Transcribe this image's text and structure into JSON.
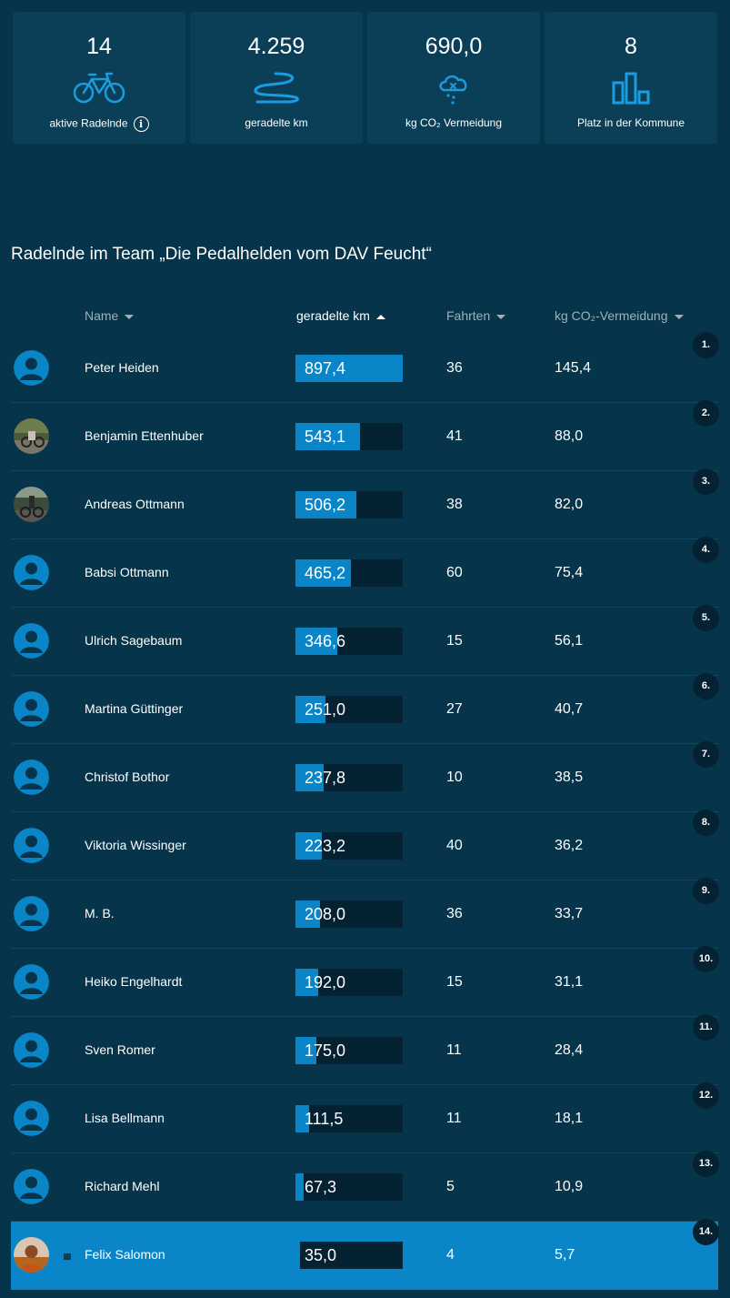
{
  "stats": [
    {
      "value": "14",
      "label": "aktive Radelnde",
      "icon": "bicycle-icon"
    },
    {
      "value": "4.259",
      "label": "geradelte km",
      "icon": "route-icon"
    },
    {
      "value": "690,0",
      "label": "kg CO₂ Vermeidung",
      "icon": "cloud-icon"
    },
    {
      "value": "8",
      "label": "Platz in der Kommune",
      "icon": "bar-chart-icon"
    }
  ],
  "team": {
    "title": "Radelnde im Team „Die Pedalhelden vom DAV Feucht“"
  },
  "table": {
    "headers": {
      "name": "Name",
      "km": "geradelte km",
      "rides": "Fahrten",
      "co2": "kg CO₂-Vermeidung"
    },
    "rows": [
      {
        "rank": "1.",
        "name": "Peter Heiden",
        "km": "897,4",
        "km_value": 897.4,
        "rides": "36",
        "co2": "145,4",
        "avatar": "default"
      },
      {
        "rank": "2.",
        "name": "Benjamin Ettenhuber",
        "km": "543,1",
        "km_value": 543.1,
        "rides": "41",
        "co2": "88,0",
        "avatar": "photo"
      },
      {
        "rank": "3.",
        "name": "Andreas Ottmann",
        "km": "506,2",
        "km_value": 506.2,
        "rides": "38",
        "co2": "82,0",
        "avatar": "photo"
      },
      {
        "rank": "4.",
        "name": "Babsi Ottmann",
        "km": "465,2",
        "km_value": 465.2,
        "rides": "60",
        "co2": "75,4",
        "avatar": "default"
      },
      {
        "rank": "5.",
        "name": "Ulrich Sagebaum",
        "km": "346,6",
        "km_value": 346.6,
        "rides": "15",
        "co2": "56,1",
        "avatar": "default"
      },
      {
        "rank": "6.",
        "name": "Martina Güttinger",
        "km": "251,0",
        "km_value": 251.0,
        "rides": "27",
        "co2": "40,7",
        "avatar": "default"
      },
      {
        "rank": "7.",
        "name": "Christof Bothor",
        "km": "237,8",
        "km_value": 237.8,
        "rides": "10",
        "co2": "38,5",
        "avatar": "default"
      },
      {
        "rank": "8.",
        "name": "Viktoria Wissinger",
        "km": "223,2",
        "km_value": 223.2,
        "rides": "40",
        "co2": "36,2",
        "avatar": "default"
      },
      {
        "rank": "9.",
        "name": "M. B.",
        "km": "208,0",
        "km_value": 208.0,
        "rides": "36",
        "co2": "33,7",
        "avatar": "default"
      },
      {
        "rank": "10.",
        "name": "Heiko Engelhardt",
        "km": "192,0",
        "km_value": 192.0,
        "rides": "15",
        "co2": "31,1",
        "avatar": "default"
      },
      {
        "rank": "11.",
        "name": "Sven Romer",
        "km": "175,0",
        "km_value": 175.0,
        "rides": "11",
        "co2": "28,4",
        "avatar": "default"
      },
      {
        "rank": "12.",
        "name": "Lisa Bellmann",
        "km": "111,5",
        "km_value": 111.5,
        "rides": "11",
        "co2": "18,1",
        "avatar": "default"
      },
      {
        "rank": "13.",
        "name": "Richard Mehl",
        "km": "67,3",
        "km_value": 67.3,
        "rides": "5",
        "co2": "10,9",
        "avatar": "default"
      },
      {
        "rank": "14.",
        "name": "Felix Salomon",
        "km": "35,0",
        "km_value": 35.0,
        "rides": "4",
        "co2": "5,7",
        "avatar": "photo",
        "highlighted": true
      }
    ]
  },
  "colors": {
    "accent": "#0a86c8",
    "background": "#06344a",
    "card": "#0b3f57",
    "bar_track": "#052233"
  }
}
